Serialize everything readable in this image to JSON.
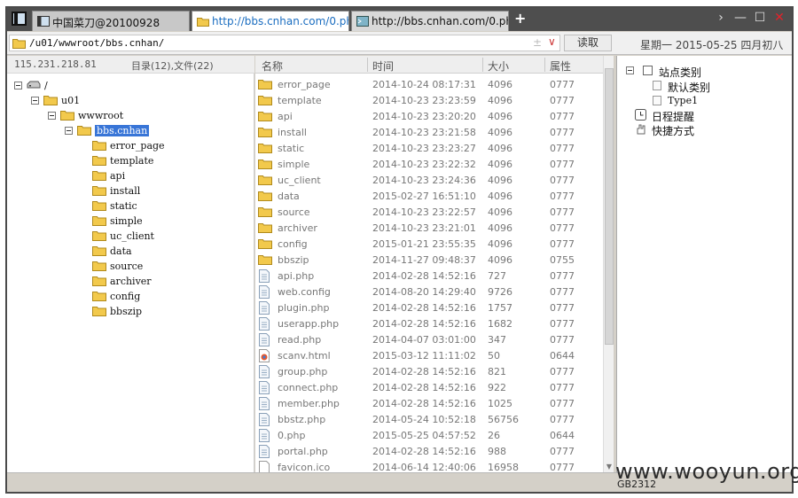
{
  "tabs": [
    {
      "label": "中国菜刀@20100928",
      "active": false
    },
    {
      "label": "http://bbs.cnhan.com/0.php",
      "active": true
    },
    {
      "label": "http://bbs.cnhan.com/0.php",
      "active": false
    }
  ],
  "new_tab_label": "+",
  "window_controls": {
    "forward": "›",
    "minimize": "—",
    "maximize": "☐",
    "close": "✕"
  },
  "address": {
    "path": "/u01/wwwroot/bbs.cnhan/",
    "plus": "±",
    "dropdown": "∨"
  },
  "read_button": "读取",
  "date_label": "星期一 2015-05-25 四月初八",
  "left_panel": {
    "ip": "115.231.218.81",
    "count": "目录(12),文件(22)",
    "tree": [
      {
        "label": "/",
        "type": "drive"
      },
      {
        "label": "u01",
        "type": "folder"
      },
      {
        "label": "wwwroot",
        "type": "folder"
      },
      {
        "label": "bbs.cnhan",
        "type": "folder",
        "selected": true
      },
      {
        "label": "error_page",
        "type": "folder"
      },
      {
        "label": "template",
        "type": "folder"
      },
      {
        "label": "api",
        "type": "folder"
      },
      {
        "label": "install",
        "type": "folder"
      },
      {
        "label": "static",
        "type": "folder"
      },
      {
        "label": "simple",
        "type": "folder"
      },
      {
        "label": "uc_client",
        "type": "folder"
      },
      {
        "label": "data",
        "type": "folder"
      },
      {
        "label": "source",
        "type": "folder"
      },
      {
        "label": "archiver",
        "type": "folder"
      },
      {
        "label": "config",
        "type": "folder"
      },
      {
        "label": "bbszip",
        "type": "folder"
      }
    ]
  },
  "file_list": {
    "columns": [
      "名称",
      "时间",
      "大小",
      "属性"
    ],
    "rows": [
      {
        "name": "error_page",
        "date": "2014-10-24 08:17:31",
        "size": "4096",
        "perm": "0777",
        "icon": "folder-icon"
      },
      {
        "name": "template",
        "date": "2014-10-23 23:23:59",
        "size": "4096",
        "perm": "0777",
        "icon": "folder-icon"
      },
      {
        "name": "api",
        "date": "2014-10-23 23:20:20",
        "size": "4096",
        "perm": "0777",
        "icon": "folder-icon"
      },
      {
        "name": "install",
        "date": "2014-10-23 23:21:58",
        "size": "4096",
        "perm": "0777",
        "icon": "folder-icon"
      },
      {
        "name": "static",
        "date": "2014-10-23 23:23:27",
        "size": "4096",
        "perm": "0777",
        "icon": "folder-icon"
      },
      {
        "name": "simple",
        "date": "2014-10-23 23:22:32",
        "size": "4096",
        "perm": "0777",
        "icon": "folder-icon"
      },
      {
        "name": "uc_client",
        "date": "2014-10-23 23:24:36",
        "size": "4096",
        "perm": "0777",
        "icon": "folder-icon"
      },
      {
        "name": "data",
        "date": "2015-02-27 16:51:10",
        "size": "4096",
        "perm": "0777",
        "icon": "folder-icon"
      },
      {
        "name": "source",
        "date": "2014-10-23 23:22:57",
        "size": "4096",
        "perm": "0777",
        "icon": "folder-icon"
      },
      {
        "name": "archiver",
        "date": "2014-10-23 23:21:01",
        "size": "4096",
        "perm": "0777",
        "icon": "folder-icon"
      },
      {
        "name": "config",
        "date": "2015-01-21 23:55:35",
        "size": "4096",
        "perm": "0777",
        "icon": "folder-icon"
      },
      {
        "name": "bbszip",
        "date": "2014-11-27 09:48:37",
        "size": "4096",
        "perm": "0755",
        "icon": "folder-icon"
      },
      {
        "name": "api.php",
        "date": "2014-02-28 14:52:16",
        "size": "727",
        "perm": "0777",
        "icon": "php-file-icon"
      },
      {
        "name": "web.config",
        "date": "2014-08-20 14:29:40",
        "size": "9726",
        "perm": "0777",
        "icon": "php-file-icon"
      },
      {
        "name": "plugin.php",
        "date": "2014-02-28 14:52:16",
        "size": "1757",
        "perm": "0777",
        "icon": "php-file-icon"
      },
      {
        "name": "userapp.php",
        "date": "2014-02-28 14:52:16",
        "size": "1682",
        "perm": "0777",
        "icon": "php-file-icon"
      },
      {
        "name": "read.php",
        "date": "2014-04-07 03:01:00",
        "size": "347",
        "perm": "0777",
        "icon": "php-file-icon"
      },
      {
        "name": "scanv.html",
        "date": "2015-03-12 11:11:02",
        "size": "50",
        "perm": "0644",
        "icon": "html-file-icon"
      },
      {
        "name": "group.php",
        "date": "2014-02-28 14:52:16",
        "size": "821",
        "perm": "0777",
        "icon": "php-file-icon"
      },
      {
        "name": "connect.php",
        "date": "2014-02-28 14:52:16",
        "size": "922",
        "perm": "0777",
        "icon": "php-file-icon"
      },
      {
        "name": "member.php",
        "date": "2014-02-28 14:52:16",
        "size": "1025",
        "perm": "0777",
        "icon": "php-file-icon"
      },
      {
        "name": "bbstz.php",
        "date": "2014-05-24 10:52:18",
        "size": "56756",
        "perm": "0777",
        "icon": "php-file-icon"
      },
      {
        "name": "0.php",
        "date": "2015-05-25 04:57:52",
        "size": "26",
        "perm": "0644",
        "icon": "php-file-icon"
      },
      {
        "name": "portal.php",
        "date": "2014-02-28 14:52:16",
        "size": "988",
        "perm": "0777",
        "icon": "php-file-icon"
      },
      {
        "name": "favicon.ico",
        "date": "2014-06-14 12:40:06",
        "size": "16958",
        "perm": "0777",
        "icon": "blank-file-icon"
      }
    ]
  },
  "right_panel": {
    "root": "站点类别",
    "children": [
      "默认类别",
      "Type1"
    ],
    "schedule": "日程提醒",
    "shortcuts": "快捷方式"
  },
  "status": {
    "encoding": "GB2312"
  },
  "watermark": "www.wooyun.org",
  "colors": {
    "selection": "#3875d7",
    "folder": "#f2c94c",
    "active_tab_text": "#1a6dc0",
    "close": "#e3222a"
  }
}
